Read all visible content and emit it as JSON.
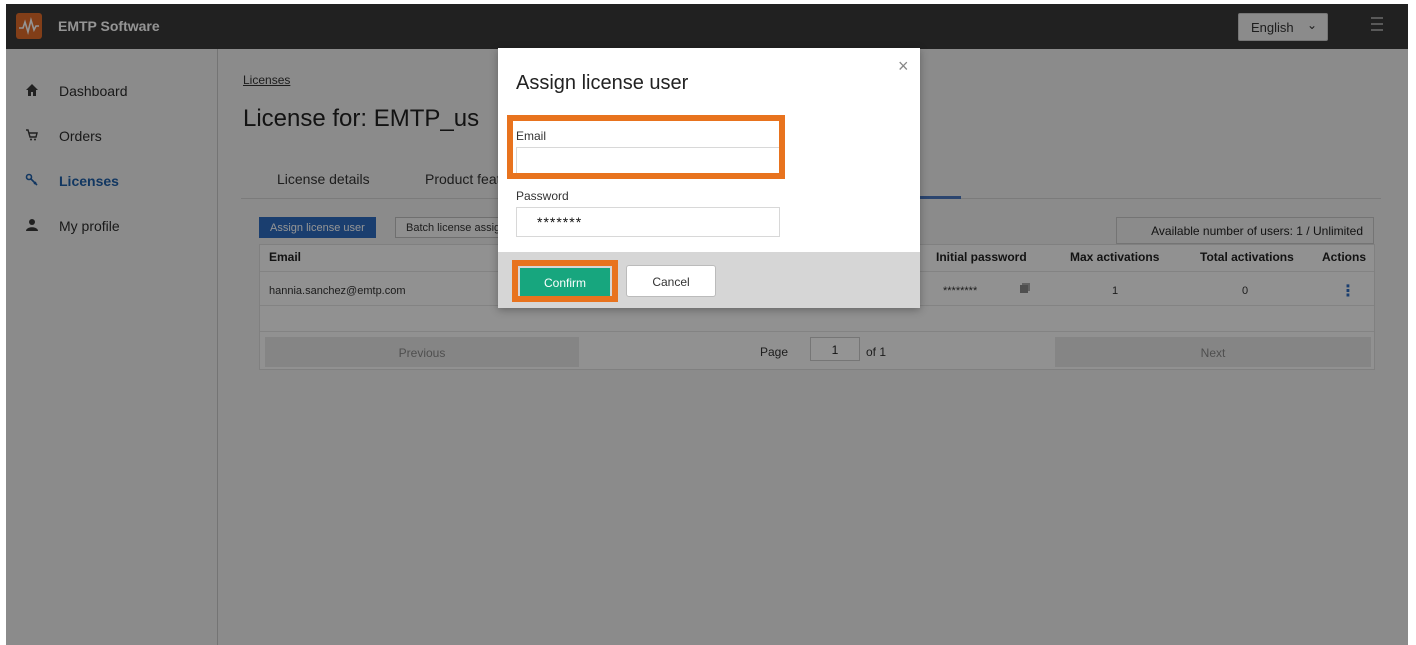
{
  "app": {
    "title": "EMTP Software",
    "brand_color": "#e06b2a",
    "accent_color": "#2d6cc0"
  },
  "header": {
    "language": "English",
    "icons": [
      "chevron-down-icon",
      "menu-icon"
    ]
  },
  "sidebar": {
    "items": [
      {
        "label": "Dashboard",
        "icon": "home-icon"
      },
      {
        "label": "Orders",
        "icon": "cart-icon"
      },
      {
        "label": "Licenses",
        "icon": "key-icon",
        "active": true
      },
      {
        "label": "My profile",
        "icon": "user-icon"
      }
    ]
  },
  "main": {
    "breadcrumb": "Licenses",
    "title": "License for: EMTP_us",
    "tabs": [
      "License details",
      "Product feat"
    ],
    "buttons": {
      "assign": "Assign license user",
      "batch": "Batch license assig"
    },
    "available": "Available number of users: 1 / Unlimited",
    "table": {
      "headers": [
        "Email",
        "Initial password",
        "Max activations",
        "Total activations",
        "Actions"
      ],
      "rows": [
        {
          "email": "hannia.sanchez@emtp.com",
          "password": "********",
          "max": "1",
          "total": "0"
        }
      ]
    },
    "pager": {
      "previous": "Previous",
      "page_label": "Page",
      "page": "1",
      "of": "of 1",
      "next": "Next"
    }
  },
  "modal": {
    "title": "Assign license user",
    "close": "×",
    "email_label": "Email",
    "email_value": "",
    "password_label": "Password",
    "password_value": "*******",
    "confirm": "Confirm",
    "cancel": "Cancel",
    "highlight_color": "#e8731e",
    "confirm_color": "#17a67e"
  }
}
